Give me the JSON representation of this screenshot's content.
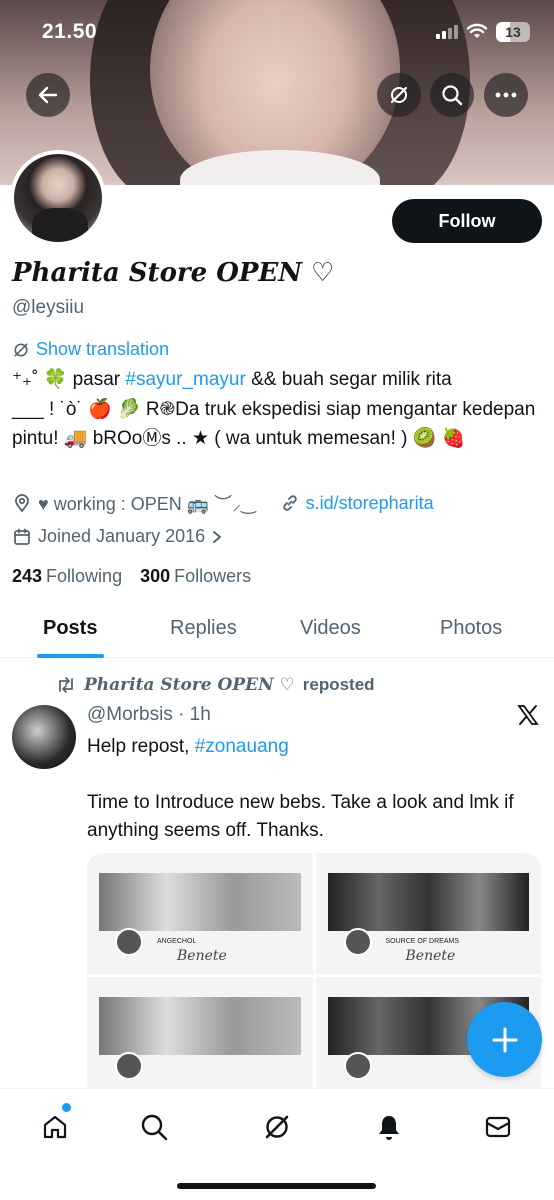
{
  "status_bar": {
    "time": "21.50",
    "battery": "13"
  },
  "profile": {
    "display_name": "Pharita Store OPEN ♡",
    "handle": "@leysiiu",
    "follow_label": "Follow",
    "show_translation": "Show translation",
    "bio_line1_pre": "⁺₊˚ 🍀 pasar ",
    "bio_hashtag": "#sayur_mayur",
    "bio_line1_post": " && buah segar milik rita",
    "bio_rest": "___ ! ˙ò˙ 🍎 🥬 R֎Da truk ekspedisi siap mengantar kedepan pintu! 🚚 bROoⓂs .. ★ ( wa untuk memesan! ) 🥝 🍓",
    "location": "♥ working : OPEN 🚌 ︶⸝‿",
    "link": "s.id/storepharita",
    "joined": "Joined January 2016",
    "following_count": "243",
    "following_label": "Following",
    "followers_count": "300",
    "followers_label": "Followers"
  },
  "tabs": [
    {
      "label": "Posts"
    },
    {
      "label": "Replies"
    },
    {
      "label": "Videos"
    },
    {
      "label": "Photos"
    }
  ],
  "post": {
    "reposted_by": "Pharita Store OPEN ♡",
    "reposted_suffix": "reposted",
    "author": "@Morbsis",
    "time": "· 1h",
    "text_pre": "Help repost, ",
    "hashtag": "#zonauang",
    "text_body": "Time to Introduce new bebs. Take a look and lmk if anything seems off. Thanks.",
    "media": [
      {
        "caption": "ANGECHOL",
        "script": "Benete"
      },
      {
        "caption": "SOURCE OF DREAMS",
        "script": "Benete"
      },
      {
        "caption": "",
        "script": ""
      },
      {
        "caption": "",
        "script": ""
      }
    ]
  },
  "nav": [
    "home-icon",
    "search-icon",
    "grok-icon",
    "notifications-icon",
    "messages-icon"
  ],
  "colors": {
    "accent": "#1d9bf0",
    "text": "#0f1419",
    "muted": "#536471"
  }
}
